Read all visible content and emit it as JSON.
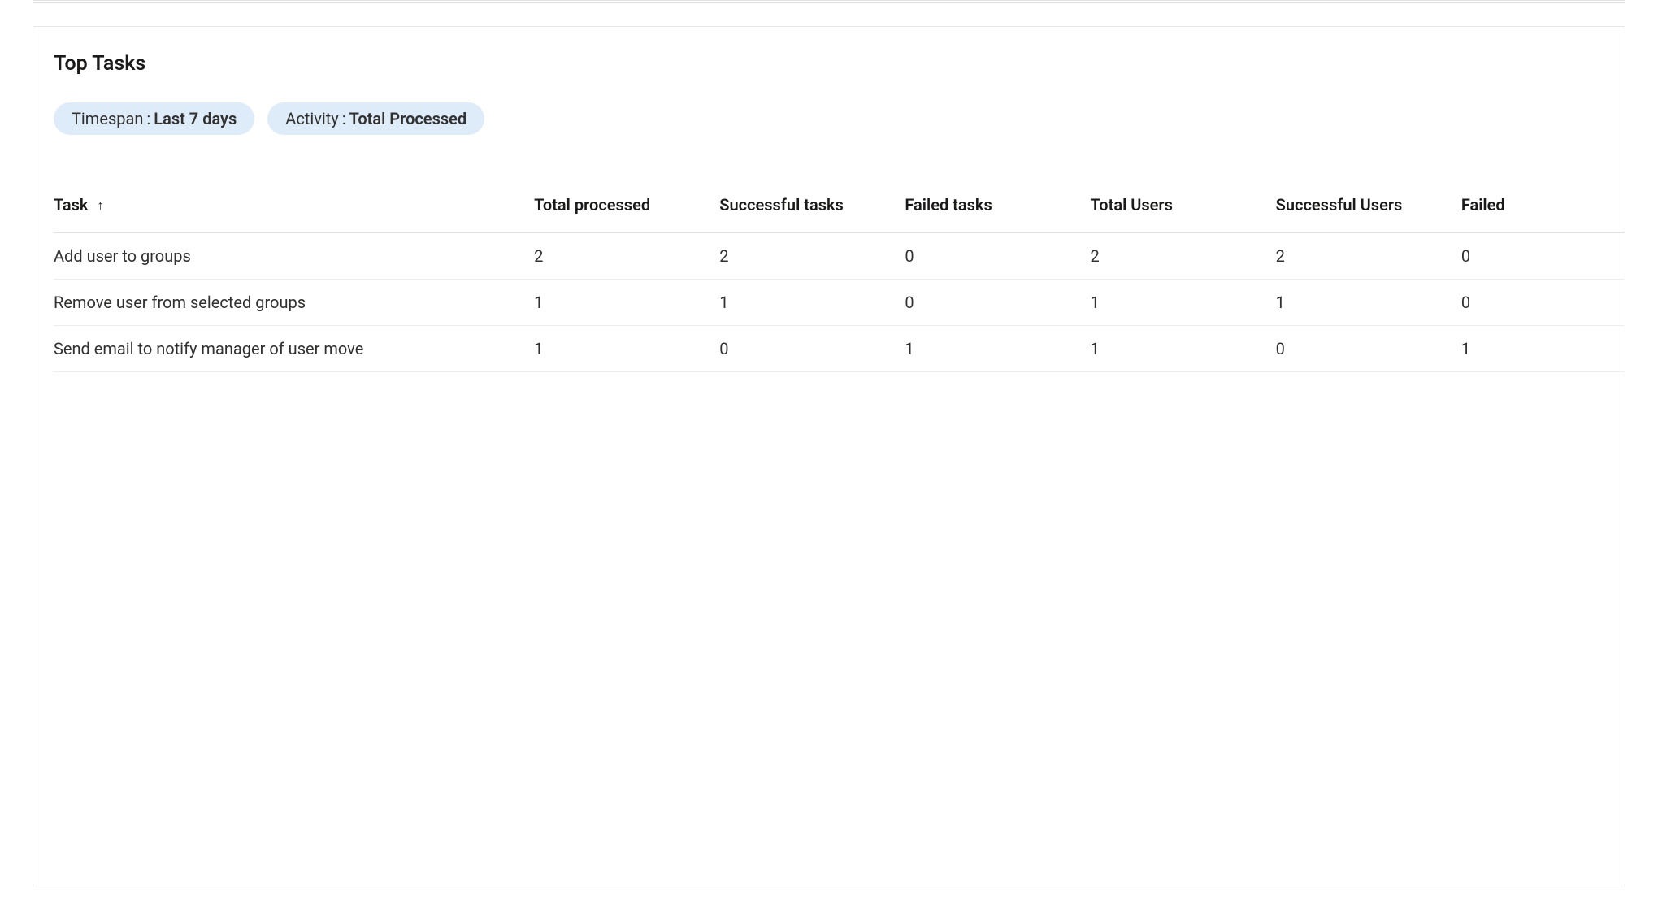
{
  "title": "Top Tasks",
  "filters": {
    "timespan": {
      "label": "Timespan",
      "value": "Last 7 days"
    },
    "activity": {
      "label": "Activity",
      "value": "Total Processed"
    }
  },
  "table": {
    "sort_icon": "↑",
    "columns": {
      "task": "Task",
      "total_processed": "Total processed",
      "successful_tasks": "Successful tasks",
      "failed_tasks": "Failed tasks",
      "total_users": "Total Users",
      "successful_users": "Successful Users",
      "failed": "Failed"
    },
    "rows": [
      {
        "task": "Add user to groups",
        "total_processed": "2",
        "successful_tasks": "2",
        "failed_tasks": "0",
        "total_users": "2",
        "successful_users": "2",
        "failed": "0"
      },
      {
        "task": "Remove user from selected groups",
        "total_processed": "1",
        "successful_tasks": "1",
        "failed_tasks": "0",
        "total_users": "1",
        "successful_users": "1",
        "failed": "0"
      },
      {
        "task": "Send email to notify manager of user move",
        "total_processed": "1",
        "successful_tasks": "0",
        "failed_tasks": "1",
        "total_users": "1",
        "successful_users": "0",
        "failed": "1"
      }
    ]
  }
}
